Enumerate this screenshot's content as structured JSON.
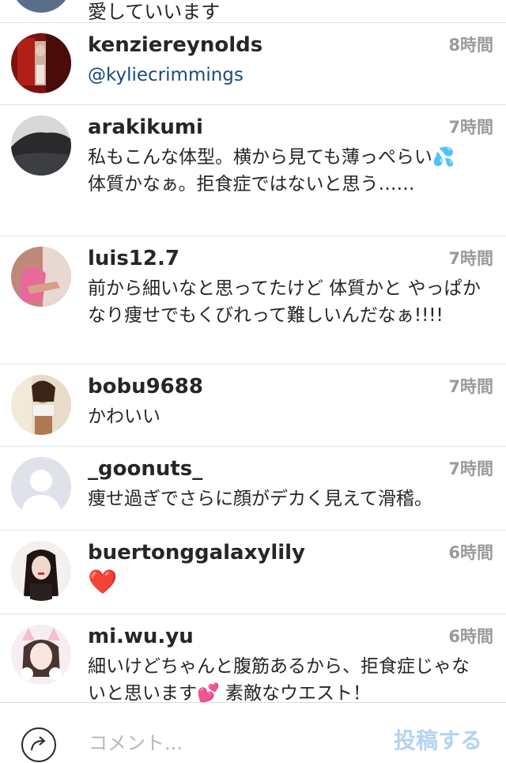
{
  "first_comment": {
    "text": "愛していいます"
  },
  "comments": [
    {
      "username": "kenziereynolds",
      "time": "8時間",
      "text": "@kyliecrimmings",
      "avatar": "red-room-photo-avatar"
    },
    {
      "username": "arakikumi",
      "time": "7時間",
      "text": "私もこんな体型。横から見ても薄っぺらい💦体質かなぁ。拒食症ではないと思う……",
      "avatar": "dark-landscape-avatar"
    },
    {
      "username": "luis12.7",
      "time": "7時間",
      "text": "前から細いなと思ってたけど 体質かと やっぱかなり痩せでもくびれって難しいんだなぁ!!!!",
      "avatar": "pink-outfit-avatar"
    },
    {
      "username": "bobu9688",
      "time": "7時間",
      "text": "かわいい",
      "avatar": "selfie-avatar"
    },
    {
      "username": "_goonuts_",
      "time": "7時間",
      "text": "痩せ過ぎでさらに顔がデカく見えて滑稽。",
      "avatar": "default-person-avatar"
    },
    {
      "username": "buertonggalaxylily",
      "time": "6時間",
      "text": "❤️",
      "avatar": "woman-portrait-avatar"
    },
    {
      "username": "mi.wu.yu",
      "time": "6時間",
      "text": "細いけどちゃんと腹筋あるから、拒食症じゃないと思います💕 素敵なウエスト！",
      "avatar": "cat-ears-selfie-avatar"
    }
  ],
  "input_bar": {
    "placeholder": "コメント...",
    "post_label": "投稿する",
    "post_color": "#b3d4f2"
  },
  "colors": {
    "mention": "#1a4a7a",
    "time": "#9a9a9a",
    "divider": "#e4e4e4"
  }
}
